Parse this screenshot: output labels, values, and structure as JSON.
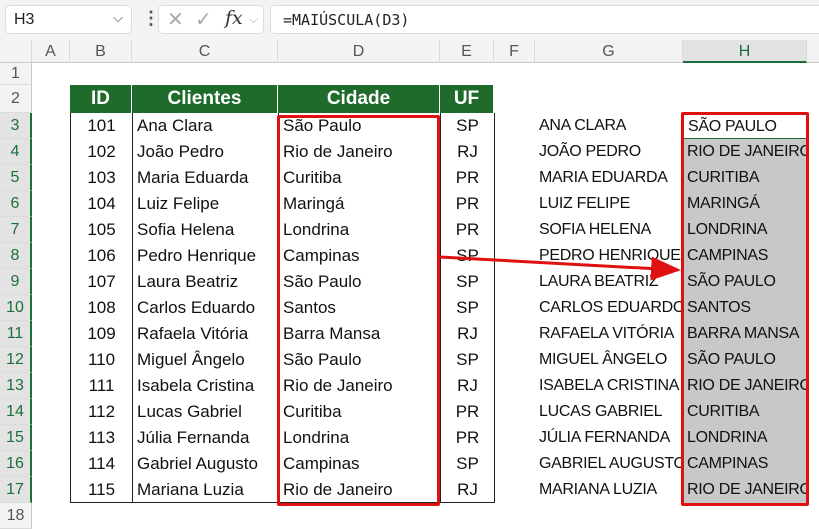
{
  "formula_bar": {
    "name_box": "H3",
    "formula": "=MAIÚSCULA(D3)",
    "cancel_icon": "✕",
    "enter_icon": "✓",
    "fx_label": "fx"
  },
  "columns": [
    "A",
    "B",
    "C",
    "D",
    "E",
    "F",
    "G",
    "H"
  ],
  "selected_column": "H",
  "row_numbers": [
    "1",
    "2",
    "3",
    "4",
    "5",
    "6",
    "7",
    "8",
    "9",
    "10",
    "11",
    "12",
    "13",
    "14",
    "15",
    "16",
    "17",
    "18"
  ],
  "table": {
    "headers": [
      "ID",
      "Clientes",
      "Cidade",
      "UF"
    ],
    "rows": [
      [
        "101",
        "Ana Clara",
        "São Paulo",
        "SP"
      ],
      [
        "102",
        "João Pedro",
        "Rio de Janeiro",
        "RJ"
      ],
      [
        "103",
        "Maria Eduarda",
        "Curitiba",
        "PR"
      ],
      [
        "104",
        "Luiz Felipe",
        "Maringá",
        "PR"
      ],
      [
        "105",
        "Sofia Helena",
        "Londrina",
        "PR"
      ],
      [
        "106",
        "Pedro Henrique",
        "Campinas",
        "SP"
      ],
      [
        "107",
        "Laura Beatriz",
        "São Paulo",
        "SP"
      ],
      [
        "108",
        "Carlos Eduardo",
        "Santos",
        "SP"
      ],
      [
        "109",
        "Rafaela Vitória",
        "Barra Mansa",
        "RJ"
      ],
      [
        "110",
        "Miguel Ângelo",
        "São Paulo",
        "SP"
      ],
      [
        "111",
        "Isabela Cristina",
        "Rio de Janeiro",
        "RJ"
      ],
      [
        "112",
        "Lucas Gabriel",
        "Curitiba",
        "PR"
      ],
      [
        "113",
        "Júlia Fernanda",
        "Londrina",
        "PR"
      ],
      [
        "114",
        "Gabriel Augusto",
        "Campinas",
        "SP"
      ],
      [
        "115",
        "Mariana Luzia",
        "Rio de Janeiro",
        "RJ"
      ]
    ]
  },
  "upper_names": [
    "ANA CLARA",
    "JOÃO PEDRO",
    "MARIA EDUARDA",
    "LUIZ FELIPE",
    "SOFIA HELENA",
    "PEDRO HENRIQUE",
    "LAURA BEATRIZ",
    "CARLOS EDUARDO",
    "RAFAELA VITÓRIA",
    "MIGUEL ÂNGELO",
    "ISABELA CRISTINA",
    "LUCAS GABRIEL",
    "JÚLIA FERNANDA",
    "GABRIEL AUGUSTO",
    "MARIANA LUZIA"
  ],
  "upper_cities": [
    "SÃO PAULO",
    "RIO DE JANEIRO",
    "CURITIBA",
    "MARINGÁ",
    "LONDRINA",
    "CAMPINAS",
    "SÃO PAULO",
    "SANTOS",
    "BARRA MANSA",
    "SÃO PAULO",
    "RIO DE JANEIRO",
    "CURITIBA",
    "LONDRINA",
    "CAMPINAS",
    "RIO DE JANEIRO"
  ],
  "colors": {
    "header_green": "#1e6b2c",
    "highlight_red": "#e01010",
    "selection_gray": "#c8c8c8"
  }
}
